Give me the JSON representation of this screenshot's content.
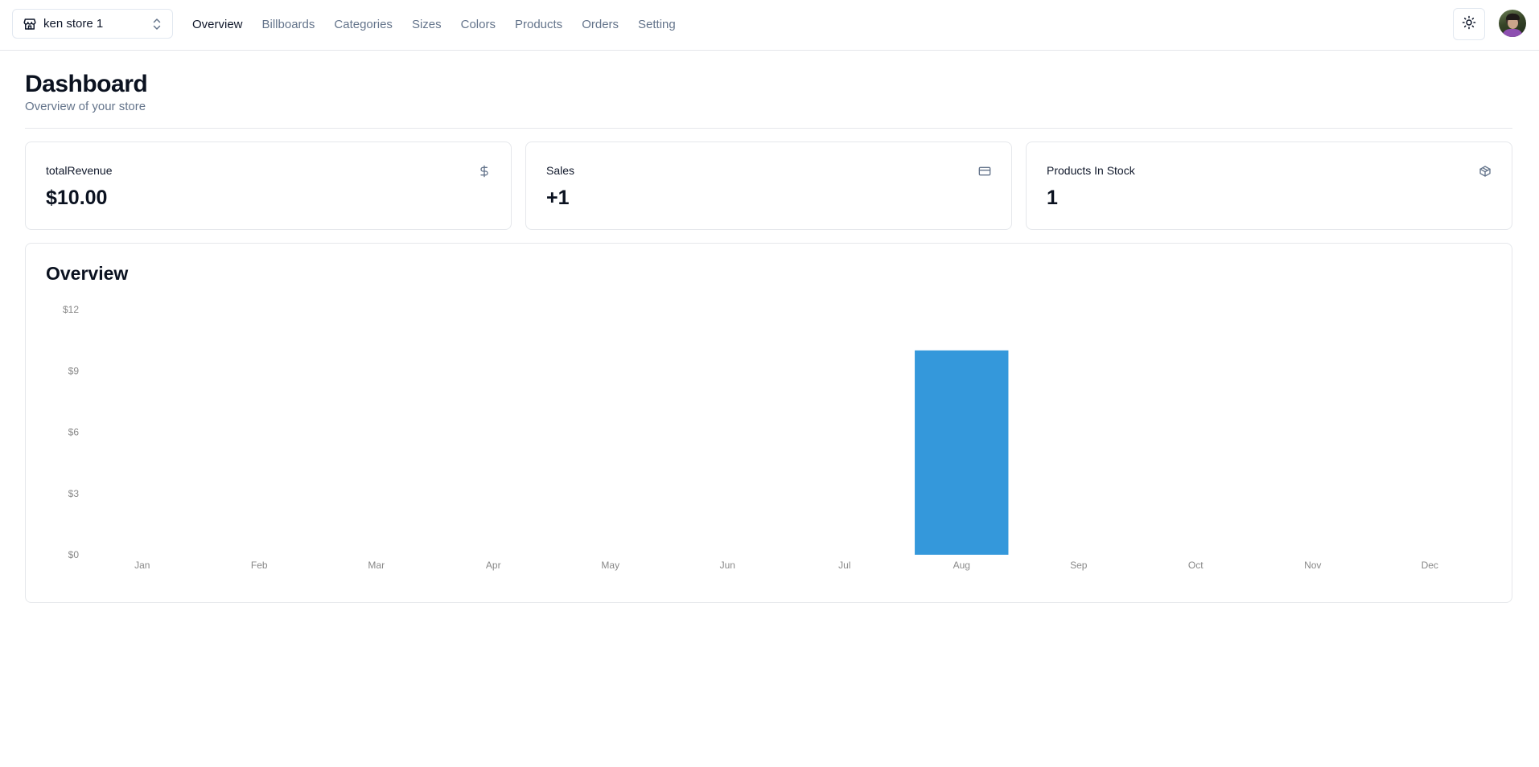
{
  "header": {
    "store_switcher": {
      "label": "ken store 1",
      "icon": "store-icon"
    },
    "nav": [
      {
        "label": "Overview",
        "active": true
      },
      {
        "label": "Billboards",
        "active": false
      },
      {
        "label": "Categories",
        "active": false
      },
      {
        "label": "Sizes",
        "active": false
      },
      {
        "label": "Colors",
        "active": false
      },
      {
        "label": "Products",
        "active": false
      },
      {
        "label": "Orders",
        "active": false
      },
      {
        "label": "Setting",
        "active": false
      }
    ],
    "theme_toggle_icon": "sun-icon",
    "avatar_icon": "user-avatar"
  },
  "page": {
    "title": "Dashboard",
    "subtitle": "Overview of your store"
  },
  "stats": [
    {
      "label": "totalRevenue",
      "value": "$10.00",
      "icon": "dollar-sign-icon"
    },
    {
      "label": "Sales",
      "value": "+1",
      "icon": "credit-card-icon"
    },
    {
      "label": "Products In Stock",
      "value": "1",
      "icon": "package-icon"
    }
  ],
  "overview": {
    "title": "Overview"
  },
  "colors": {
    "bar": "#3498db",
    "muted_text": "#64748b",
    "border": "#e5e7eb"
  },
  "chart_data": {
    "type": "bar",
    "categories": [
      "Jan",
      "Feb",
      "Mar",
      "Apr",
      "May",
      "Jun",
      "Jul",
      "Aug",
      "Sep",
      "Oct",
      "Nov",
      "Dec"
    ],
    "values": [
      0,
      0,
      0,
      0,
      0,
      0,
      0,
      10,
      0,
      0,
      0,
      0
    ],
    "ylim": [
      0,
      12
    ],
    "yticks": [
      0,
      3,
      6,
      9,
      12
    ],
    "ytick_labels": [
      "$0",
      "$3",
      "$6",
      "$9",
      "$12"
    ],
    "title": "",
    "xlabel": "",
    "ylabel": "",
    "grid": false,
    "legend": "none"
  }
}
